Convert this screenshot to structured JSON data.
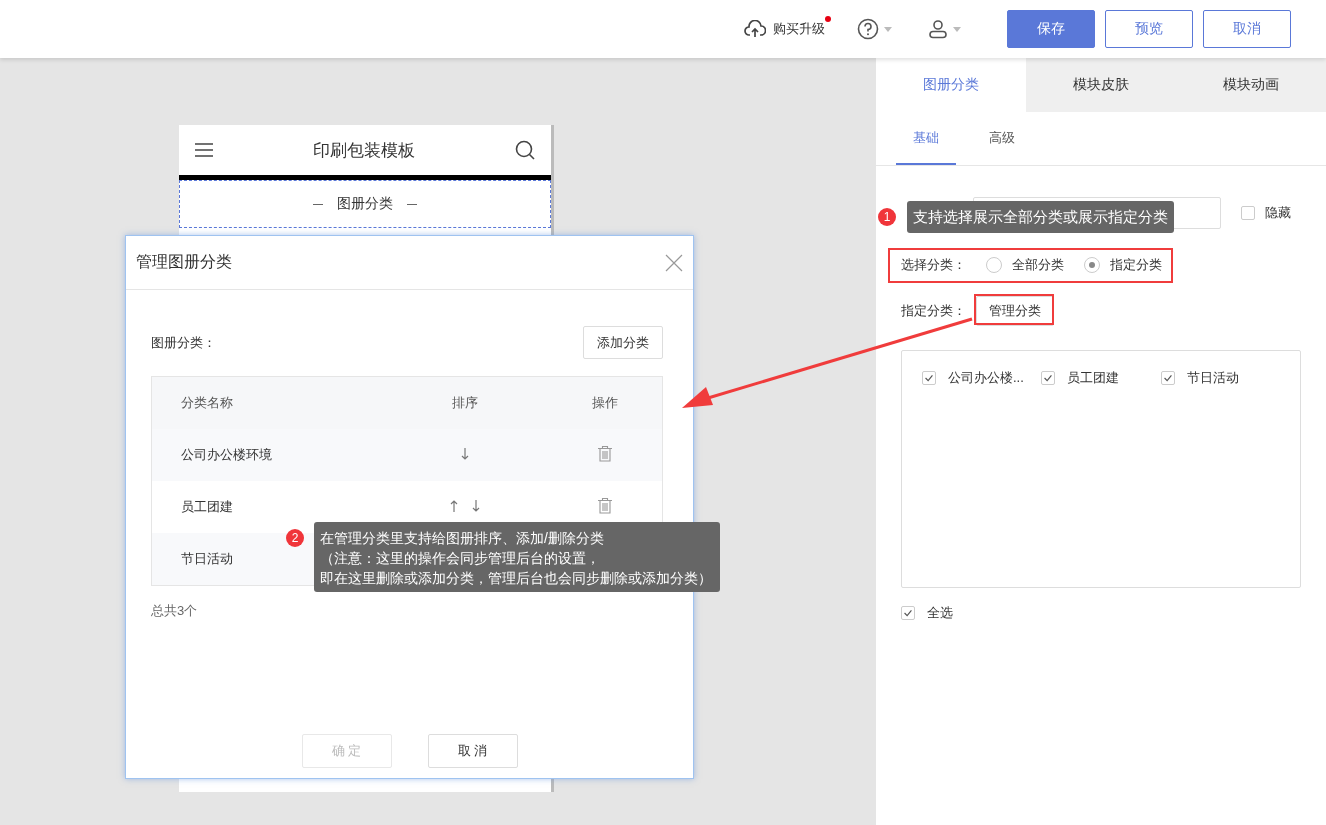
{
  "topbar": {
    "upgrade": {
      "label": "购买升级",
      "notification": true
    },
    "buttons": [
      {
        "label": "保存",
        "kind": "primary"
      },
      {
        "label": "预览",
        "kind": "outline"
      },
      {
        "label": "取消",
        "kind": "outline"
      }
    ]
  },
  "preview": {
    "title": "印刷包装模板",
    "section_title": "图册分类"
  },
  "panel": {
    "tabs": [
      {
        "label": "图册分类",
        "selected": true
      },
      {
        "label": "模块皮肤",
        "selected": false
      },
      {
        "label": "模块动画",
        "selected": false
      }
    ],
    "subtabs": [
      {
        "label": "基础",
        "selected": true
      },
      {
        "label": "高级",
        "selected": false
      }
    ],
    "hide_checkbox": {
      "label": "隐藏",
      "checked": false
    },
    "select": {
      "label": "选择分类：",
      "options": [
        {
          "label": "全部分类",
          "selected": false
        },
        {
          "label": "指定分类",
          "selected": true
        }
      ]
    },
    "specify": {
      "label": "指定分类：",
      "button": "管理分类"
    },
    "categories": [
      {
        "label": "公司办公楼...",
        "checked": true
      },
      {
        "label": "员工团建",
        "checked": true
      },
      {
        "label": "节日活动",
        "checked": true
      }
    ],
    "select_all": {
      "label": "全选",
      "checked": true
    }
  },
  "dialog": {
    "title": "管理图册分类",
    "list_label": "图册分类：",
    "add_button": "添加分类",
    "columns": [
      "分类名称",
      "排序",
      "操作"
    ],
    "rows": [
      {
        "name": "公司办公楼环境",
        "up": false,
        "down": true,
        "delete": true
      },
      {
        "name": "员工团建",
        "up": true,
        "down": true,
        "delete": true
      },
      {
        "name": "节日活动"
      }
    ],
    "total": "总共3个",
    "buttons": [
      {
        "label": "确 定",
        "disabled": true
      },
      {
        "label": "取 消",
        "disabled": false
      }
    ]
  },
  "annotations": [
    {
      "number": "1",
      "text": "支持选择展示全部分类或展示指定分类"
    },
    {
      "number": "2",
      "lines": [
        "在管理分类里支持给图册排序、添加/删除分类",
        "（注意：这里的操作会同步管理后台的设置，",
        "即在这里删除或添加分类，管理后台也会同步删除或添加分类）"
      ]
    }
  ]
}
